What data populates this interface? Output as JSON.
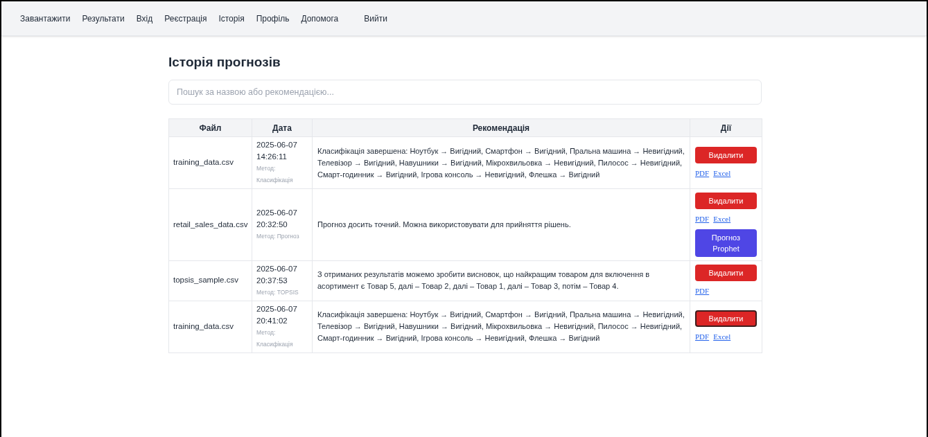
{
  "nav": [
    "Завантажити",
    "Результати",
    "Вхід",
    "Реєстрація",
    "Історія",
    "Профіль",
    "Допомога",
    "Вийти"
  ],
  "title": "Історія прогнозів",
  "search": {
    "placeholder": "Пошук за назвою або рекомендацією..."
  },
  "table": {
    "columns": [
      "Файл",
      "Дата",
      "Рекомендація",
      "Дії"
    ],
    "rows": [
      {
        "file": "training_data.csv",
        "date": "2025-06-07",
        "time": "14:26:11",
        "method": "Метод: Класифікація",
        "recommendation": "Класифікація завершена: Ноутбук → Вигідний, Смартфон → Вигідний, Пральна машина → Невигідний, Телевізор → Вигідний, Навушники → Вигідний, Мікрохвильовка → Невигідний, Пилосос → Невигідний, Смарт-годинник → Вигідний, Ігрова консоль → Невигідний, Флешка → Вигідний",
        "delete": {
          "label": "Видалити",
          "focused": false
        },
        "links": [
          "PDF",
          "Excel"
        ]
      },
      {
        "file": "retail_sales_data.csv",
        "date": "2025-06-07",
        "time": "20:32:50",
        "method": "Метод: Прогноз",
        "recommendation": "Прогноз досить точний. Можна використовувати для прийняття рішень.",
        "delete": {
          "label": "Видалити",
          "focused": false
        },
        "links": [
          "PDF",
          "Excel"
        ],
        "extra_button": "Прогноз Prophet"
      },
      {
        "file": "topsis_sample.csv",
        "date": "2025-06-07",
        "time": "20:37:53",
        "method": "Метод: TOPSIS",
        "recommendation": "З отриманих результатів можемо зробити висновок, що найкращим товаром для включення в асортимент є Товар 5, далі – Товар 2, далі – Товар 1, далі – Товар 3, потім – Товар 4.",
        "delete": {
          "label": "Видалити",
          "focused": false
        },
        "links": [
          "PDF"
        ]
      },
      {
        "file": "training_data.csv",
        "date": "2025-06-07",
        "time": "20:41:02",
        "method": "Метод: Класифікація",
        "recommendation": "Класифікація завершена: Ноутбук → Вигідний, Смартфон → Вигідний, Пральна машина → Невигідний, Телевізор → Вигідний, Навушники → Вигідний, Мікрохвильовка → Невигідний, Пилосос → Невигідний, Смарт-годинник → Вигідний, Ігрова консоль → Невигідний, Флешка → Вигідний",
        "delete": {
          "label": "Видалити",
          "focused": true
        },
        "links": [
          "PDF",
          "Excel"
        ]
      }
    ]
  }
}
